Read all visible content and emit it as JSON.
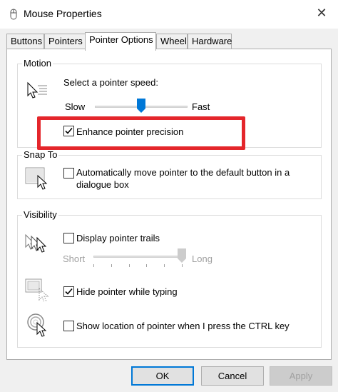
{
  "window": {
    "title": "Mouse Properties",
    "close_glyph": "✕"
  },
  "tabs": [
    {
      "label": "Buttons"
    },
    {
      "label": "Pointers"
    },
    {
      "label": "Pointer Options",
      "active": true
    },
    {
      "label": "Wheel"
    },
    {
      "label": "Hardware"
    }
  ],
  "motion": {
    "group_label": "Motion",
    "speed_label": "Select a pointer speed:",
    "slow_label": "Slow",
    "fast_label": "Fast",
    "speed_fraction": 0.5,
    "enhance_label": "Enhance pointer precision",
    "enhance_checked": true
  },
  "snap_to": {
    "group_label": "Snap To",
    "auto_label_line1": "Automatically move pointer to the default button in a",
    "auto_label_line2": "dialogue box",
    "auto_checked": false
  },
  "visibility": {
    "group_label": "Visibility",
    "trails_label": "Display pointer trails",
    "trails_checked": false,
    "short_label": "Short",
    "long_label": "Long",
    "trail_fraction": 1.0,
    "hide_label": "Hide pointer while typing",
    "hide_checked": true,
    "show_location_label": "Show location of pointer when I press the CTRL key",
    "show_location_checked": false
  },
  "buttons": {
    "ok": "OK",
    "cancel": "Cancel",
    "apply": "Apply"
  },
  "colors": {
    "highlight": "#e4262b",
    "accent": "#0078d7",
    "slider_thumb": "#0078d7"
  }
}
